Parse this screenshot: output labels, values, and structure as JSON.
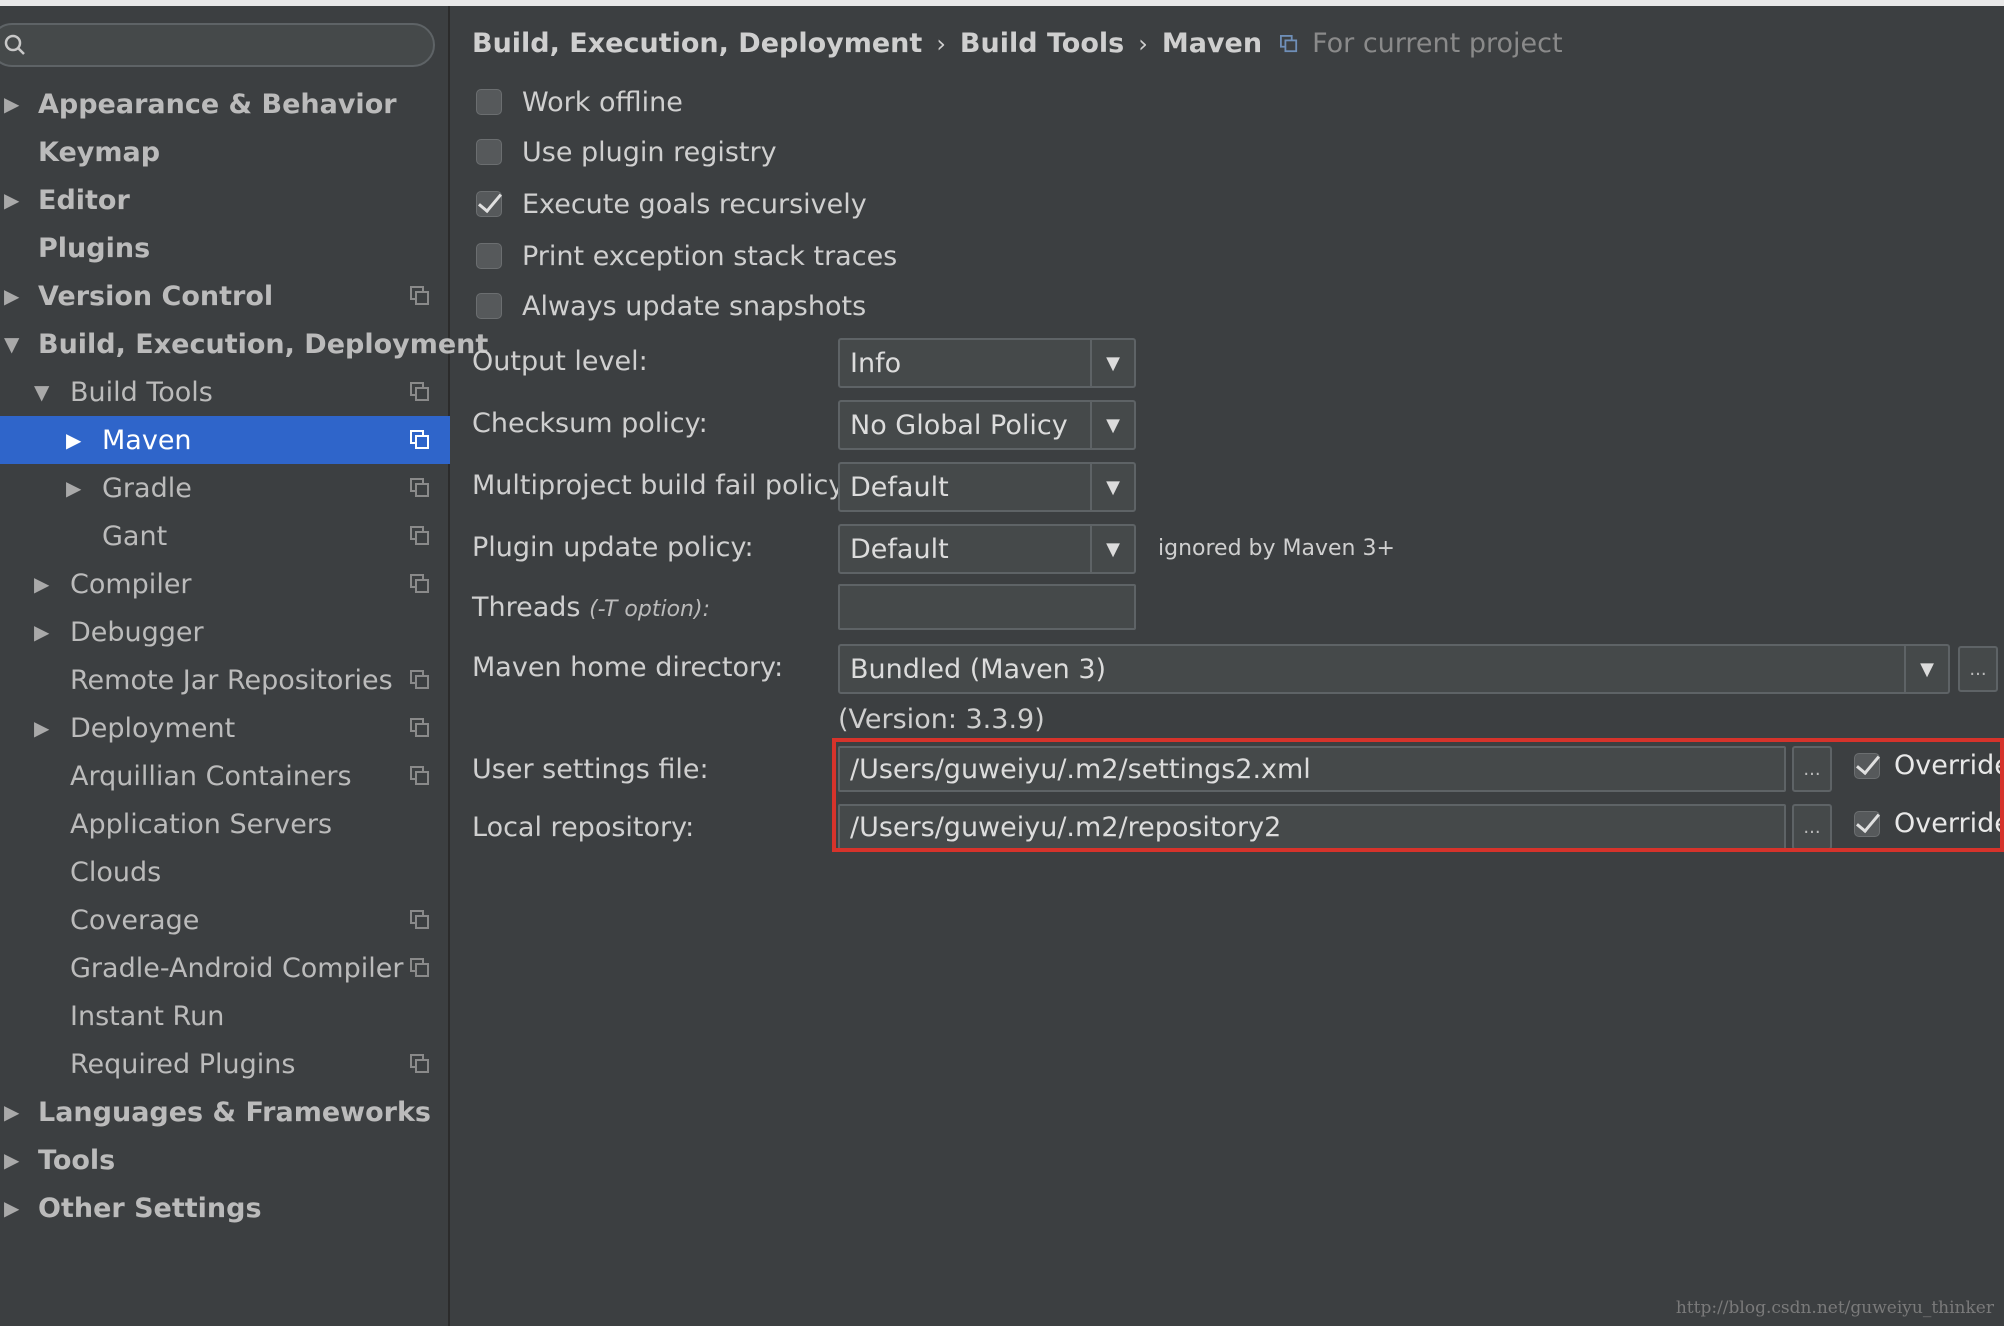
{
  "search": {
    "placeholder": ""
  },
  "sidebar": {
    "items": [
      {
        "label": "Appearance & Behavior"
      },
      {
        "label": "Keymap"
      },
      {
        "label": "Editor"
      },
      {
        "label": "Plugins"
      },
      {
        "label": "Version Control"
      },
      {
        "label": "Build, Execution, Deployment"
      },
      {
        "label": "Build Tools"
      },
      {
        "label": "Maven"
      },
      {
        "label": "Gradle"
      },
      {
        "label": "Gant"
      },
      {
        "label": "Compiler"
      },
      {
        "label": "Debugger"
      },
      {
        "label": "Remote Jar Repositories"
      },
      {
        "label": "Deployment"
      },
      {
        "label": "Arquillian Containers"
      },
      {
        "label": "Application Servers"
      },
      {
        "label": "Clouds"
      },
      {
        "label": "Coverage"
      },
      {
        "label": "Gradle-Android Compiler"
      },
      {
        "label": "Instant Run"
      },
      {
        "label": "Required Plugins"
      },
      {
        "label": "Languages & Frameworks"
      },
      {
        "label": "Tools"
      },
      {
        "label": "Other Settings"
      }
    ]
  },
  "breadcrumb": {
    "seg1": "Build, Execution, Deployment",
    "seg2": "Build Tools",
    "seg3": "Maven",
    "sep": "›",
    "note": "For current project"
  },
  "options": {
    "work_offline": "Work offline",
    "use_plugin_registry": "Use plugin registry",
    "execute_goals": "Execute goals recursively",
    "print_exception": "Print exception stack traces",
    "always_update": "Always update snapshots"
  },
  "form": {
    "output_level_label": "Output level:",
    "output_level_value": "Info",
    "checksum_label": "Checksum policy:",
    "checksum_value": "No Global Policy",
    "multiproject_label": "Multiproject build fail policy:",
    "multiproject_value": "Default",
    "plugin_update_label": "Plugin update policy:",
    "plugin_update_value": "Default",
    "plugin_update_note": "ignored by Maven 3+",
    "threads_label": "Threads",
    "threads_hint": "(-T option):",
    "threads_value": "",
    "maven_home_label": "Maven home directory:",
    "maven_home_value": "Bundled (Maven 3)",
    "maven_version": "(Version: 3.3.9)",
    "user_settings_label": "User settings file:",
    "user_settings_value": "/Users/guweiyu/.m2/settings2.xml",
    "local_repo_label": "Local repository:",
    "local_repo_value": "/Users/guweiyu/.m2/repository2",
    "override_label": "Override",
    "browse_label": "..."
  },
  "watermark": "http://blog.csdn.net/guweiyu_thinker",
  "colors": {
    "selection": "#2f65ca",
    "highlight_box": "#d6332b",
    "background": "#3c3f41"
  }
}
